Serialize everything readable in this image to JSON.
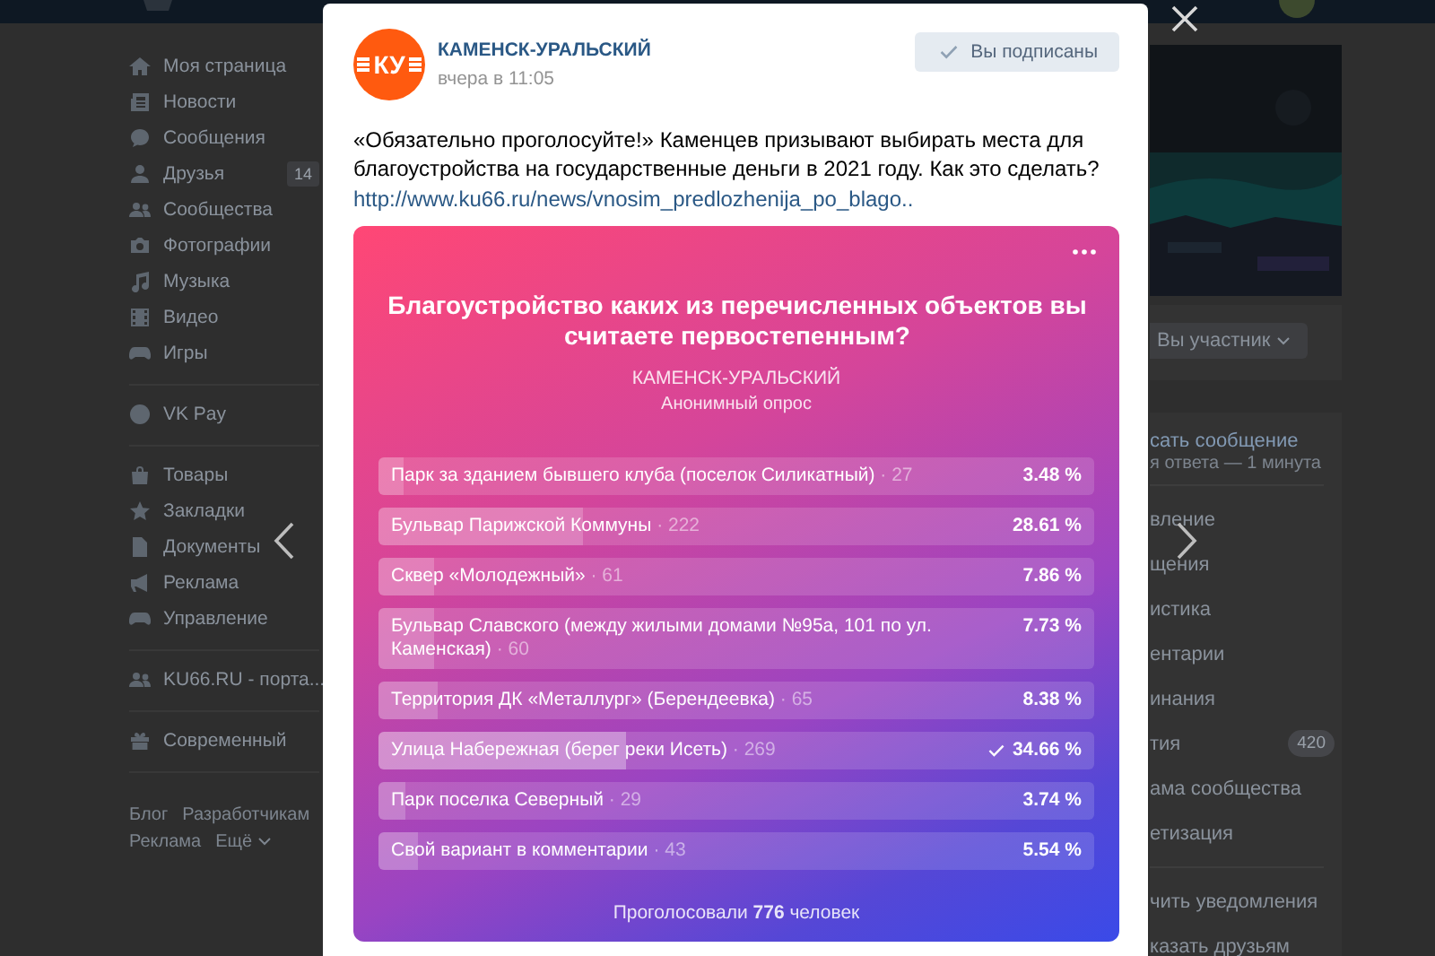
{
  "sidebar": {
    "groups": [
      {
        "items": [
          {
            "label": "Моя страница"
          },
          {
            "label": "Новости"
          },
          {
            "label": "Сообщения"
          },
          {
            "label": "Друзья",
            "badge": "14"
          },
          {
            "label": "Сообщества"
          },
          {
            "label": "Фотографии"
          },
          {
            "label": "Музыка"
          },
          {
            "label": "Видео"
          },
          {
            "label": "Игры"
          }
        ]
      },
      {
        "items": [
          {
            "label": "VK Pay"
          }
        ]
      },
      {
        "items": [
          {
            "label": "Товары"
          },
          {
            "label": "Закладки"
          },
          {
            "label": "Документы"
          },
          {
            "label": "Реклама"
          },
          {
            "label": "Управление"
          }
        ]
      },
      {
        "items": [
          {
            "label": "KU66.RU - порта..."
          }
        ]
      },
      {
        "items": [
          {
            "label": "Современный"
          }
        ]
      }
    ],
    "footer_links": [
      {
        "label": "Блог",
        "dropdown": false
      },
      {
        "label": "Разработчикам",
        "dropdown": false
      },
      {
        "label": "Реклама",
        "dropdown": false
      },
      {
        "label": "Ещё",
        "dropdown": true
      }
    ]
  },
  "post": {
    "logo_text": "КУ",
    "author": "КАМЕНСК-УРАЛЬСКИЙ",
    "time": "вчера в 11:05",
    "subscribe_button": "Вы подписаны",
    "subscribed": true,
    "text": "«Обязательно проголосуйте!» Каменцев призывают выбирать места для благоустройства на государственные деньги в 2021 году. Как это сделать?",
    "link": "http://www.ku66.ru/news/vnosim_predlozhenija_po_blago..",
    "poll": {
      "question": "Благоустройство каких из перечисленных объектов вы считаете первостепенным?",
      "author": "КАМЕНСК-УРАЛЬСКИЙ",
      "type": "Анонимный опрос",
      "options": [
        {
          "label": "Парк за зданием бывшего клуба (поселок Силикатный)",
          "count": "· 27",
          "percent": "3.48 %",
          "level": 0.0348,
          "selected": false
        },
        {
          "label": "Бульвар Парижской Коммуны",
          "count": "· 222",
          "percent": "28.61 %",
          "level": 0.2861,
          "selected": false
        },
        {
          "label": "Сквер «Молодежный»",
          "count": "· 61",
          "percent": "7.86 %",
          "level": 0.0786,
          "selected": false
        },
        {
          "label": "Бульвар Славского (между жилыми домами №95а, 101 по ул. Каменская)",
          "count": "· 60",
          "percent": "7.73 %",
          "level": 0.0773,
          "selected": false
        },
        {
          "label": "Территория ДК «Металлург» (Берендеевка)",
          "count": "· 65",
          "percent": "8.38 %",
          "level": 0.0838,
          "selected": false
        },
        {
          "label": "Улица Набережная (берег реки Исеть)",
          "count": "· 269",
          "percent": "34.66 %",
          "level": 0.3466,
          "selected": true
        },
        {
          "label": "Парк поселка Северный",
          "count": "· 29",
          "percent": "3.74 %",
          "level": 0.0374,
          "selected": false
        },
        {
          "label": "Свой вариант в комментарии",
          "count": "· 43",
          "percent": "5.54 %",
          "level": 0.0554,
          "selected": false
        }
      ],
      "total": "Проголосовали **776** человек"
    }
  },
  "right_panel": {
    "member_button": "Вы участник",
    "message": {
      "title": "сать сообщение",
      "subtitle": "я ответа — 1 минута"
    },
    "menu": [
      {
        "label": "вление"
      },
      {
        "label": "щения"
      },
      {
        "label": "истика"
      },
      {
        "label": "ентарии"
      },
      {
        "label": "инания"
      },
      {
        "label": "тия",
        "badge": "420"
      },
      {
        "label": "ама сообщества"
      },
      {
        "label": "етизация"
      }
    ],
    "actions": [
      {
        "label": "чить уведомления"
      },
      {
        "label": "казать друзьям"
      }
    ]
  }
}
